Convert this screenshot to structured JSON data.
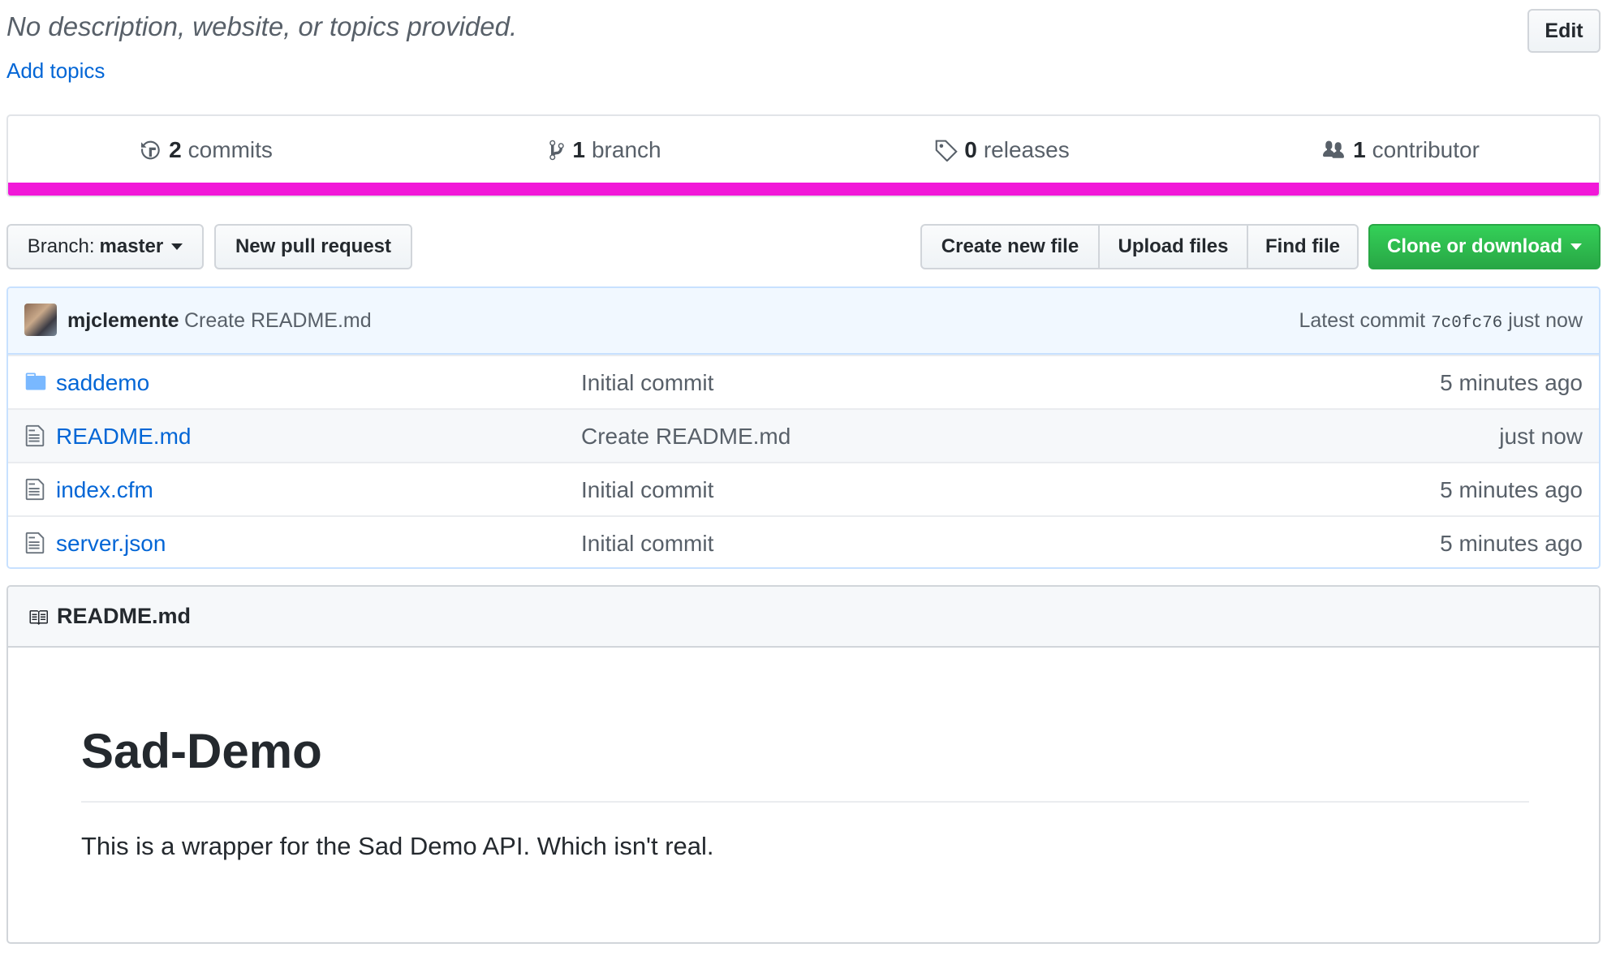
{
  "repo": {
    "description": "No description, website, or topics provided.",
    "add_topics": "Add topics",
    "edit_label": "Edit"
  },
  "summary": {
    "commits": {
      "count": "2",
      "label": "commits",
      "icon": "history-icon"
    },
    "branches": {
      "count": "1",
      "label": "branch",
      "icon": "git-branch-icon"
    },
    "releases": {
      "count": "0",
      "label": "releases",
      "icon": "tag-icon"
    },
    "contributors": {
      "count": "1",
      "label": "contributor",
      "icon": "people-icon"
    },
    "language_color": "#f118d8"
  },
  "toolbar": {
    "branch_prefix": "Branch:",
    "branch_name": "master",
    "new_pull_request": "New pull request",
    "create_new_file": "Create new file",
    "upload_files": "Upload files",
    "find_file": "Find file",
    "clone_or_download": "Clone or download",
    "clone_color": "#28a745"
  },
  "latest_commit": {
    "author": "mjclemente",
    "message": "Create README.md",
    "label": "Latest commit",
    "sha": "7c0fc76",
    "time": "just now"
  },
  "files": [
    {
      "name": "saddemo",
      "type": "folder",
      "icon": "folder-icon",
      "message": "Initial commit",
      "age": "5 minutes ago"
    },
    {
      "name": "README.md",
      "type": "file",
      "icon": "file-icon",
      "message": "Create README.md",
      "age": "just now"
    },
    {
      "name": "index.cfm",
      "type": "file",
      "icon": "file-icon",
      "message": "Initial commit",
      "age": "5 minutes ago"
    },
    {
      "name": "server.json",
      "type": "file",
      "icon": "file-icon",
      "message": "Initial commit",
      "age": "5 minutes ago"
    }
  ],
  "readme": {
    "filename": "README.md",
    "heading": "Sad-Demo",
    "body": "This is a wrapper for the Sad Demo API. Which isn't real."
  }
}
